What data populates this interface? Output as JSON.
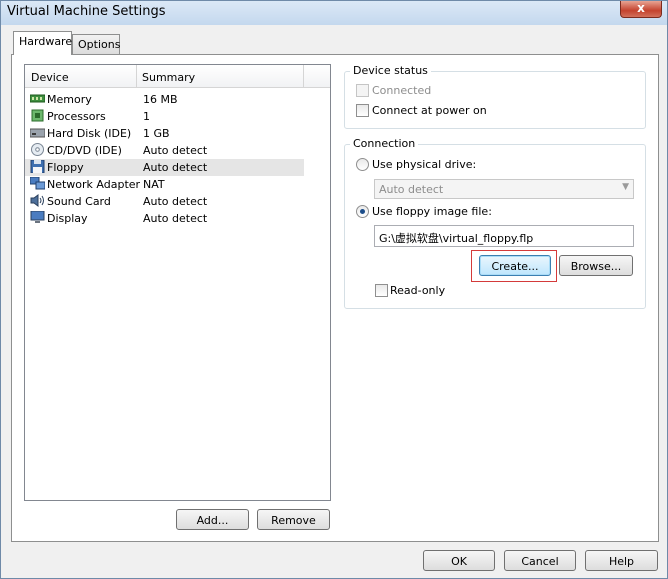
{
  "window": {
    "title": "Virtual Machine Settings",
    "close_glyph": "x"
  },
  "tabs": [
    {
      "label": "Hardware",
      "active": true
    },
    {
      "label": "Options",
      "active": false
    }
  ],
  "device_list": {
    "col_device": "Device",
    "col_summary": "Summary",
    "rows": [
      {
        "name": "Memory",
        "summary": "16 MB",
        "icon": "memory-icon",
        "selected": false
      },
      {
        "name": "Processors",
        "summary": "1",
        "icon": "processor-icon",
        "selected": false
      },
      {
        "name": "Hard Disk (IDE)",
        "summary": "1 GB",
        "icon": "hard-disk-icon",
        "selected": false
      },
      {
        "name": "CD/DVD (IDE)",
        "summary": "Auto detect",
        "icon": "cd-dvd-icon",
        "selected": false
      },
      {
        "name": "Floppy",
        "summary": "Auto detect",
        "icon": "floppy-icon",
        "selected": true
      },
      {
        "name": "Network Adapter",
        "summary": "NAT",
        "icon": "network-adapter-icon",
        "selected": false
      },
      {
        "name": "Sound Card",
        "summary": "Auto detect",
        "icon": "sound-card-icon",
        "selected": false
      },
      {
        "name": "Display",
        "summary": "Auto detect",
        "icon": "display-icon",
        "selected": false
      }
    ]
  },
  "list_buttons": {
    "add": "Add...",
    "remove": "Remove"
  },
  "device_status": {
    "legend": "Device status",
    "connected": {
      "label": "Connected",
      "checked": false,
      "disabled": true
    },
    "connect_at_power_on": {
      "label": "Connect at power on",
      "checked": false
    }
  },
  "connection": {
    "legend": "Connection",
    "use_physical_drive": {
      "label": "Use physical drive:",
      "selected": false
    },
    "physical_drive_value": "Auto detect",
    "use_image_file": {
      "label": "Use floppy image file:",
      "selected": true
    },
    "image_path": "G:\\虚拟软盘\\virtual_floppy.flp",
    "create_button": "Create...",
    "browse_button": "Browse...",
    "read_only": {
      "label": "Read-only",
      "checked": false
    }
  },
  "footer": {
    "ok": "OK",
    "cancel": "Cancel",
    "help": "Help"
  },
  "colors": {
    "highlight_box": "#d43a3a",
    "selection": "#e5e5e5",
    "radio_dot": "#1c4d8a"
  }
}
